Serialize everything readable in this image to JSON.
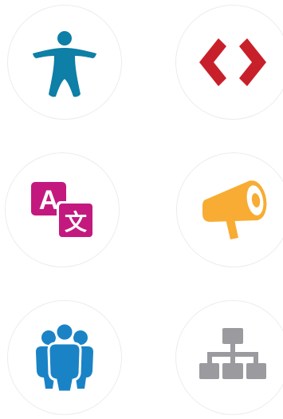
{
  "icons": [
    {
      "name": "accessibility-icon",
      "color": "#0e7fa6"
    },
    {
      "name": "code-icon",
      "color": "#c8202a"
    },
    {
      "name": "translate-icon",
      "color": "#c3197f",
      "glyph_latin": "A",
      "glyph_cjk": "文"
    },
    {
      "name": "megaphone-icon",
      "color": "#f8ac33"
    },
    {
      "name": "people-group-icon",
      "color": "#1a83c6"
    },
    {
      "name": "sitemap-icon",
      "color": "#9b9b9f"
    }
  ]
}
